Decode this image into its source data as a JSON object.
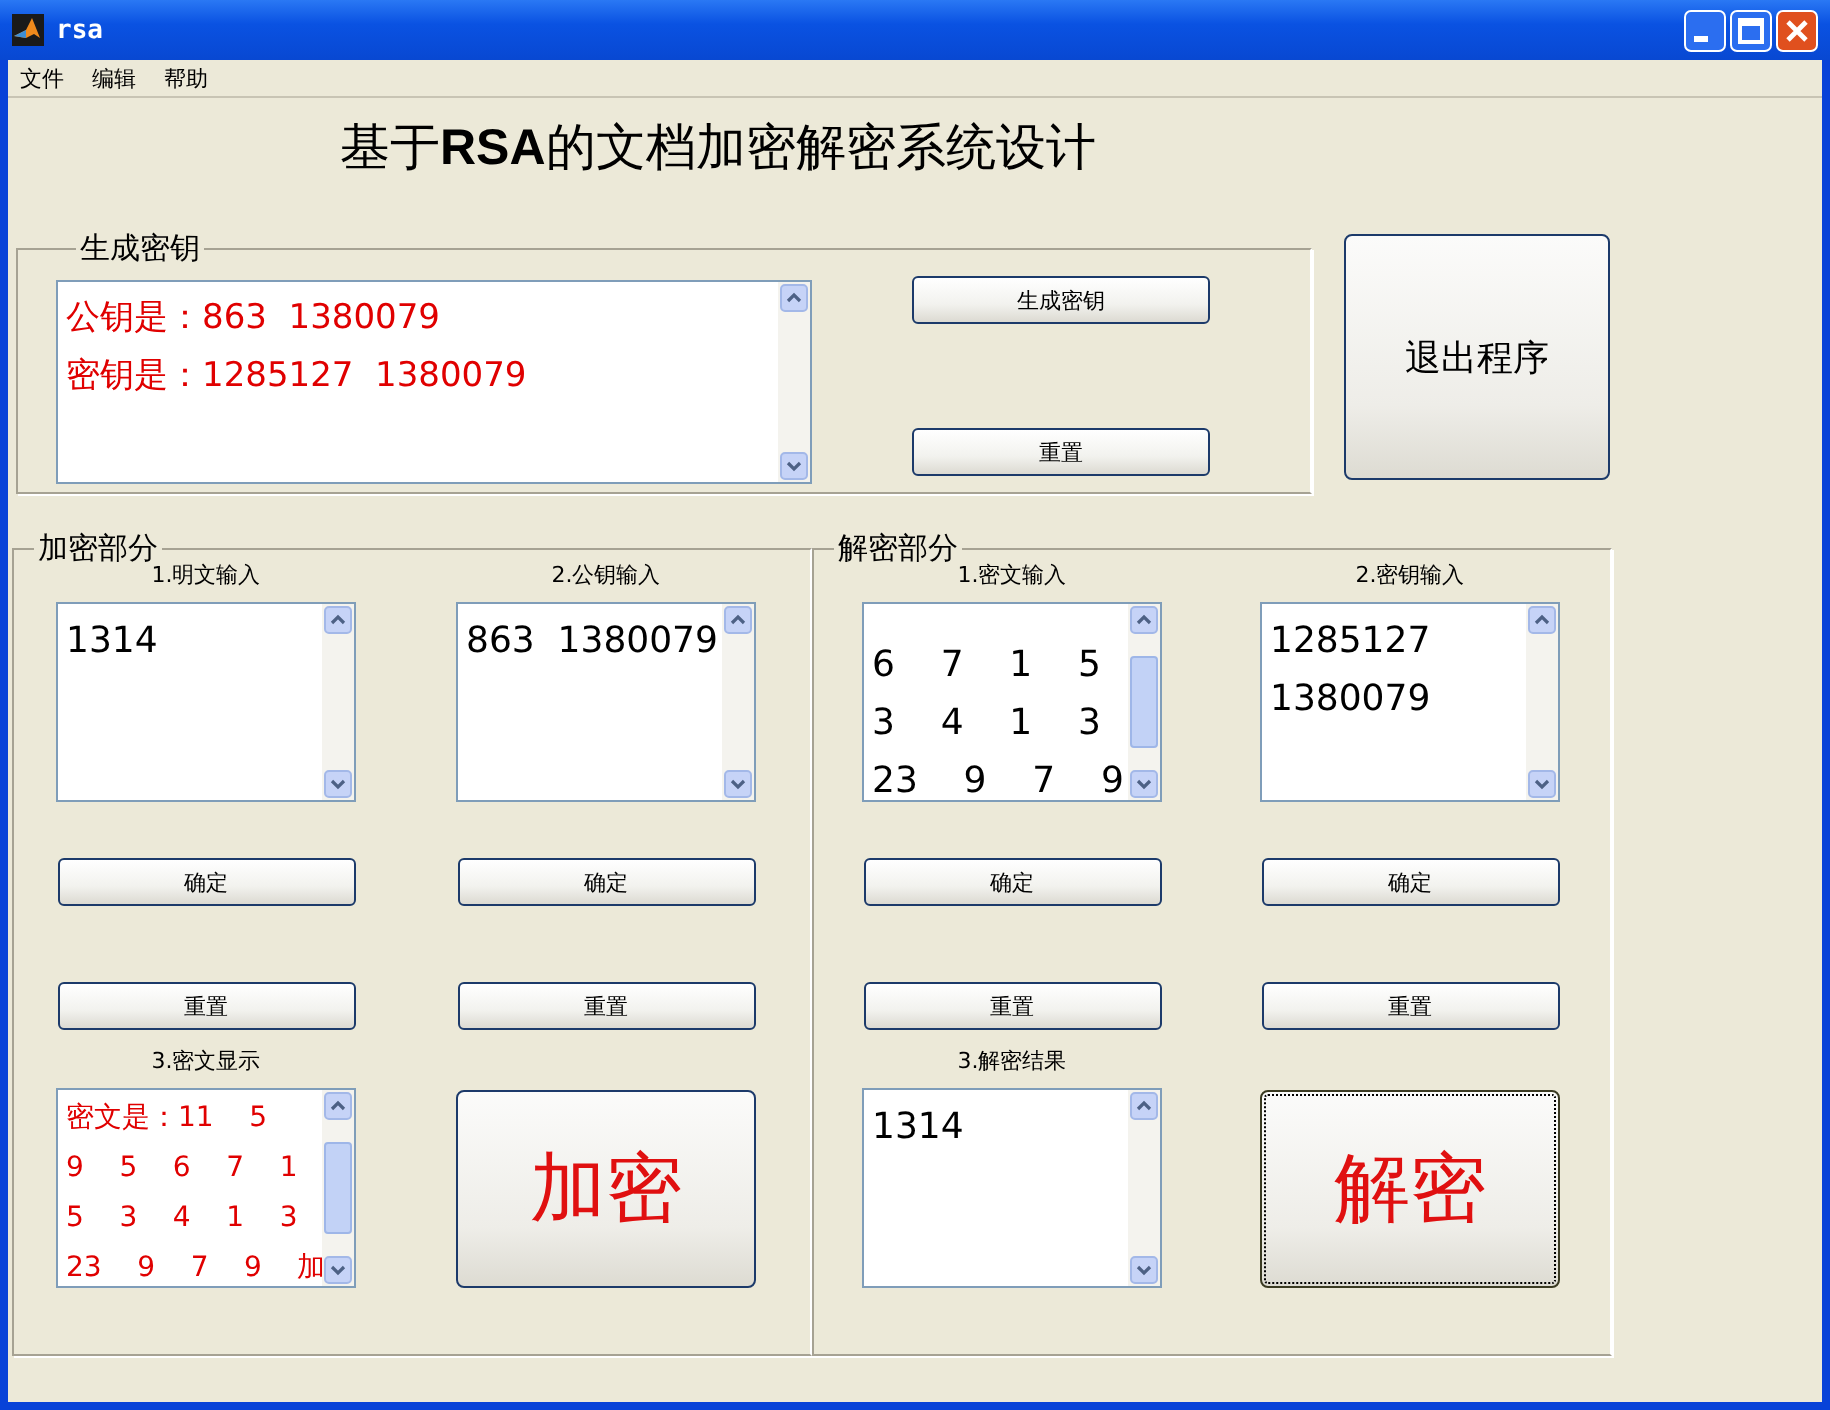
{
  "window": {
    "title": "rsa"
  },
  "menu": [
    "文件",
    "编辑",
    "帮助"
  ],
  "heading": "基于**RSA**的文档加密解密系统设计",
  "keygen": {
    "legend": "生成密钥",
    "box": {
      "lines": [
        "公钥是：863  1380079",
        "密钥是：1285127  1380079"
      ],
      "color": "#e00000",
      "overflow": false
    },
    "generate": "生成密钥",
    "reset": "重置"
  },
  "exit_button": "退出程序",
  "panels": [
    {
      "legend": "加密部分",
      "inputs": [
        {
          "label": "1.明文输入",
          "box": {
            "lines": [
              "1314"
            ],
            "color": "#000000",
            "overflow": false
          },
          "confirm": "确定",
          "reset": "重置"
        },
        {
          "label": "2.公钥输入",
          "box": {
            "lines": [
              "863  1380079"
            ],
            "color": "#000000",
            "overflow": false
          },
          "confirm": "确定",
          "reset": "重置"
        }
      ],
      "output": {
        "label": "3.密文显示",
        "box": {
          "lines": [
            "密文是：11    5",
            "9    5    6    7    1",
            "5    3    4    1    3",
            "23    9    7    9    加"
          ],
          "color": "#e00000",
          "overflow": true,
          "small": true
        }
      },
      "action": {
        "label": "加密",
        "focused": false
      }
    },
    {
      "legend": "解密部分",
      "inputs": [
        {
          "label": "1.密文输入",
          "box": {
            "lines": [
              "6    7    1    5",
              "3    4    1    3",
              "23    9    7    9"
            ],
            "color": "#000000",
            "overflow": true,
            "offset": true
          },
          "confirm": "确定",
          "reset": "重置"
        },
        {
          "label": "2.密钥输入",
          "box": {
            "lines": [
              "1285127",
              "1380079"
            ],
            "color": "#000000",
            "overflow": false
          },
          "confirm": "确定",
          "reset": "重置"
        }
      ],
      "output": {
        "label": "3.解密结果",
        "box": {
          "lines": [
            "1314"
          ],
          "color": "#000000",
          "overflow": false
        }
      },
      "action": {
        "label": "解密",
        "focused": true
      }
    }
  ]
}
